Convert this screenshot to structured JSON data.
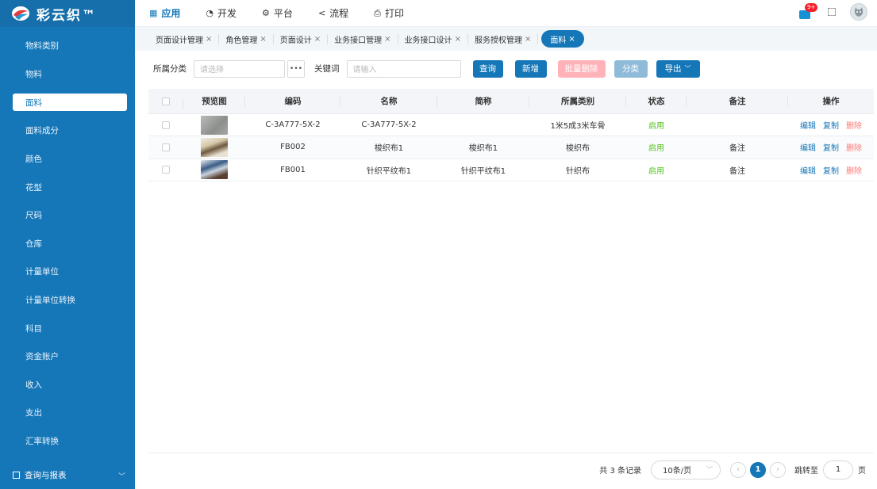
{
  "app": {
    "title": "彩云织™"
  },
  "topnav": [
    {
      "icon": "grid-icon",
      "label": "应用",
      "active": true
    },
    {
      "icon": "develop-icon",
      "label": "开发"
    },
    {
      "icon": "gear-icon",
      "label": "平台"
    },
    {
      "icon": "share-icon",
      "label": "流程"
    },
    {
      "icon": "printer-icon",
      "label": "打印"
    }
  ],
  "notifications": {
    "badge": "9+"
  },
  "sidebar": {
    "items": [
      {
        "label": "物料类别"
      },
      {
        "label": "物料"
      },
      {
        "label": "面料",
        "active": true
      },
      {
        "label": "面料成分"
      },
      {
        "label": "颜色"
      },
      {
        "label": "花型"
      },
      {
        "label": "尺码"
      },
      {
        "label": "仓库"
      },
      {
        "label": "计量单位"
      },
      {
        "label": "计量单位转换"
      },
      {
        "label": "科目"
      },
      {
        "label": "资金账户"
      },
      {
        "label": "收入"
      },
      {
        "label": "支出"
      },
      {
        "label": "汇率转换"
      }
    ],
    "group": {
      "label": "查询与报表"
    }
  },
  "tabs": [
    {
      "label": "页面设计管理"
    },
    {
      "label": "角色管理"
    },
    {
      "label": "页面设计"
    },
    {
      "label": "业务接口管理"
    },
    {
      "label": "业务接口设计"
    },
    {
      "label": "服务授权管理"
    },
    {
      "label": "面料",
      "active": true
    }
  ],
  "filters": {
    "category_label": "所属分类",
    "category_placeholder": "请选择",
    "keyword_label": "关键词",
    "keyword_placeholder": "请输入",
    "buttons": {
      "query": "查询",
      "add": "新增",
      "batch_delete": "批量删除",
      "classify": "分类",
      "export": "导出"
    }
  },
  "table": {
    "headers": {
      "preview": "预览图",
      "code": "编码",
      "name": "名称",
      "short": "简称",
      "category": "所属类别",
      "status": "状态",
      "remark": "备注",
      "actions": "操作"
    },
    "rows": [
      {
        "code": "C-3A777-5X-2",
        "name": "C-3A777-5X-2",
        "short": "",
        "category": "1米5成3米车骨",
        "status": "启用",
        "remark": "",
        "thumb": "gray"
      },
      {
        "code": "FB002",
        "name": "梭织布1",
        "short": "梭织布1",
        "category": "梭织布",
        "status": "启用",
        "remark": "备注",
        "thumb": "beige"
      },
      {
        "code": "FB001",
        "name": "针织平纹布1",
        "short": "针织平纹布1",
        "category": "针织布",
        "status": "启用",
        "remark": "备注",
        "thumb": "blue"
      }
    ],
    "actions": {
      "edit": "编辑",
      "copy": "复制",
      "delete": "删除"
    }
  },
  "pagination": {
    "total_text": "共 3 条记录",
    "page_size": "10条/页",
    "current_page": "1",
    "jump_label": "跳转至",
    "jump_value": "1",
    "page_suffix": "页"
  },
  "colors": {
    "sidebar_bg": "#1677b8",
    "primary": "#1677b8",
    "disabled_primary": "#8fbbd9",
    "danger_light": "#ffb3b8",
    "success": "#52c41a"
  }
}
